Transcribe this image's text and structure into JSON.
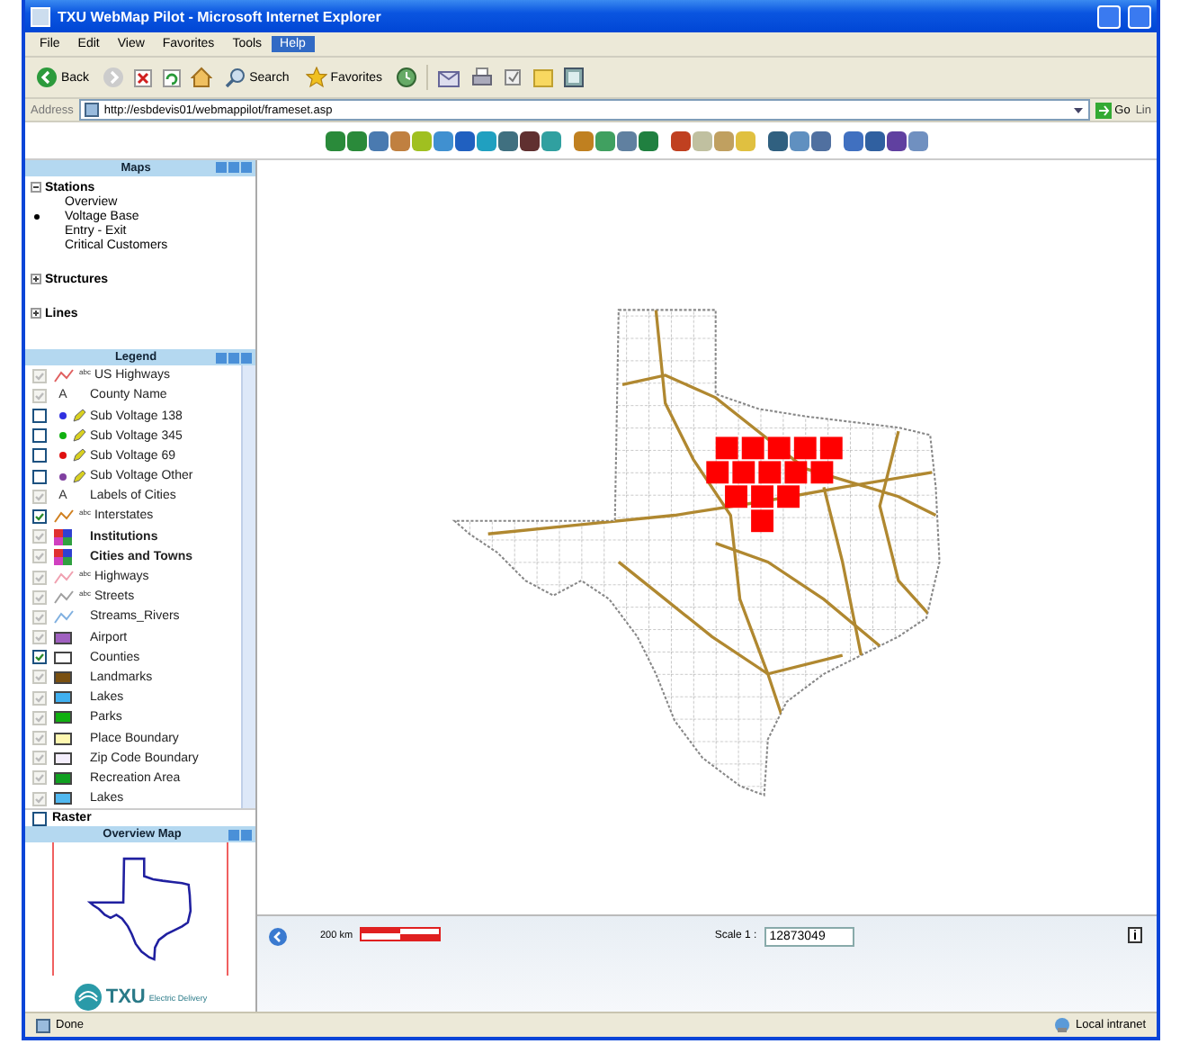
{
  "window": {
    "title": "TXU WebMap Pilot - Microsoft Internet Explorer"
  },
  "menu": [
    {
      "label": "File",
      "selected": false
    },
    {
      "label": "Edit",
      "selected": false
    },
    {
      "label": "View",
      "selected": false
    },
    {
      "label": "Favorites",
      "selected": false
    },
    {
      "label": "Tools",
      "selected": false
    },
    {
      "label": "Help",
      "selected": true
    }
  ],
  "toolbar": {
    "back": "Back",
    "search": "Search",
    "favorites": "Favorites"
  },
  "address": {
    "label": "Address",
    "value": "http://esbdevis01/webmappilot/frameset.asp",
    "go": "Go",
    "links": "Lin"
  },
  "maps_panel": {
    "title": "Maps",
    "groups": [
      {
        "label": "Stations",
        "expanded": true,
        "children": [
          {
            "label": "Overview",
            "selected": false
          },
          {
            "label": "Voltage Base",
            "selected": true
          },
          {
            "label": "Entry - Exit",
            "selected": false
          },
          {
            "label": "Critical Customers",
            "selected": false
          }
        ]
      },
      {
        "label": "Structures",
        "expanded": false
      },
      {
        "label": "Lines",
        "expanded": false
      }
    ]
  },
  "legend": {
    "title": "Legend",
    "items": [
      {
        "kind": "line",
        "label": "US Highways",
        "tag": "abc",
        "color": "#e06060",
        "checked": true,
        "disabled": true
      },
      {
        "kind": "text",
        "symbol": "A",
        "label": "County Name",
        "checked": true,
        "disabled": true
      },
      {
        "kind": "dot",
        "label": "Sub Voltage 138",
        "color": "#3030e0",
        "checked": false,
        "disabled": false
      },
      {
        "kind": "dot",
        "label": "Sub Voltage 345",
        "color": "#10b010",
        "checked": false,
        "disabled": false
      },
      {
        "kind": "dot",
        "label": "Sub Voltage 69",
        "color": "#e01010",
        "checked": false,
        "disabled": false
      },
      {
        "kind": "dot",
        "label": "Sub Voltage Other",
        "color": "#8040a0",
        "checked": false,
        "disabled": false
      },
      {
        "kind": "text",
        "symbol": "A",
        "label": "Labels of Cities",
        "checked": true,
        "disabled": true
      },
      {
        "kind": "line",
        "label": "Interstates",
        "tag": "abc",
        "color": "#d08020",
        "checked": true,
        "disabled": false
      },
      {
        "kind": "group",
        "label": "Institutions",
        "checked": true,
        "disabled": true
      },
      {
        "kind": "group",
        "label": "Cities and Towns",
        "checked": true,
        "disabled": true
      },
      {
        "kind": "line",
        "label": "Highways",
        "tag": "abc",
        "color": "#f0a0b0",
        "checked": true,
        "disabled": true
      },
      {
        "kind": "line",
        "label": "Streets",
        "tag": "abc",
        "color": "#a0a0a0",
        "checked": true,
        "disabled": true
      },
      {
        "kind": "line",
        "label": "Streams_Rivers",
        "color": "#80b0e0",
        "checked": true,
        "disabled": true
      },
      {
        "kind": "swatch",
        "label": "Airport",
        "color": "#a060c0",
        "checked": true,
        "disabled": true
      },
      {
        "kind": "swatch",
        "label": "Counties",
        "color": "#ffffff",
        "checked": true,
        "disabled": false
      },
      {
        "kind": "swatch",
        "label": "Landmarks",
        "color": "#7a5010",
        "checked": true,
        "disabled": true
      },
      {
        "kind": "swatch",
        "label": "Lakes",
        "color": "#40b0f0",
        "checked": true,
        "disabled": true
      },
      {
        "kind": "swatch",
        "label": "Parks",
        "color": "#10b010",
        "checked": true,
        "disabled": true
      },
      {
        "kind": "swatch",
        "label": "Place Boundary",
        "color": "#fff8b0",
        "checked": true,
        "disabled": true
      },
      {
        "kind": "swatch",
        "label": "Zip Code Boundary",
        "color": "#f4eefc",
        "checked": true,
        "disabled": true
      },
      {
        "kind": "swatch",
        "label": "Recreation Area",
        "color": "#10a020",
        "checked": true,
        "disabled": true
      },
      {
        "kind": "swatch",
        "label": "Lakes",
        "color": "#50b8f0",
        "checked": true,
        "disabled": true
      }
    ]
  },
  "raster": {
    "label": "Raster",
    "checked": false
  },
  "overview": {
    "title": "Overview Map",
    "logo": "TXU",
    "tagline": "Electric Delivery"
  },
  "scale": {
    "bar_label": "200 km",
    "label": "Scale 1 :",
    "value": "12873049"
  },
  "status_bar": {
    "text": "Done",
    "zone": "Local intranet"
  }
}
